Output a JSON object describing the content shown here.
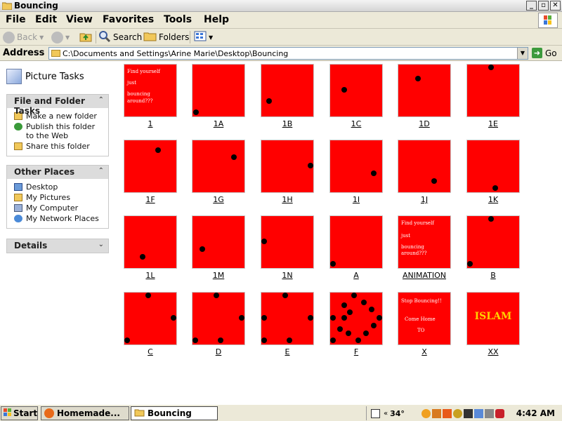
{
  "window": {
    "title": "Bouncing"
  },
  "menu": [
    "File",
    "Edit",
    "View",
    "Favorites",
    "Tools",
    "Help"
  ],
  "toolbar": {
    "back": "Back",
    "search": "Search",
    "folders": "Folders"
  },
  "address": {
    "label": "Address",
    "value": "C:\\Documents and Settings\\Arine Marie\\Desktop\\Bouncing",
    "go": "Go"
  },
  "sidebar": {
    "picture_tasks": "Picture Tasks",
    "file_folder": {
      "title": "File and Folder Tasks",
      "items": [
        "Make a new folder",
        "Publish this folder to the Web",
        "Share this folder"
      ]
    },
    "other_places": {
      "title": "Other Places",
      "items": [
        "Desktop",
        "My Pictures",
        "My Computer",
        "My Network Places"
      ]
    },
    "details": {
      "title": "Details"
    }
  },
  "files": [
    {
      "name": "1",
      "caption": [
        "Find yourself",
        "just",
        "bouncing",
        "around???"
      ]
    },
    {
      "name": "1A"
    },
    {
      "name": "1B"
    },
    {
      "name": "1C"
    },
    {
      "name": "1D"
    },
    {
      "name": "1E"
    },
    {
      "name": "1F"
    },
    {
      "name": "1G"
    },
    {
      "name": "1H"
    },
    {
      "name": "1I"
    },
    {
      "name": "1J"
    },
    {
      "name": "1K"
    },
    {
      "name": "1L"
    },
    {
      "name": "1M"
    },
    {
      "name": "1N"
    },
    {
      "name": "A"
    },
    {
      "name": "ANIMATION",
      "caption": [
        "Find yourself",
        "just",
        "bouncing",
        "around???"
      ]
    },
    {
      "name": "B"
    },
    {
      "name": "C"
    },
    {
      "name": "D"
    },
    {
      "name": "E"
    },
    {
      "name": "F"
    },
    {
      "name": "X",
      "caption": [
        "Stop Bouncing!!",
        "Come Home",
        "TO"
      ]
    },
    {
      "name": "XX",
      "caption": [
        "ISLAM"
      ]
    }
  ],
  "taskbar": {
    "start": "Start",
    "tasks": [
      "Homemade...",
      "Bouncing"
    ],
    "temperature": "34°",
    "clock": "4:42 AM"
  },
  "colors": {
    "thumb": "#ff0000",
    "islam_text": "#ffd000"
  }
}
